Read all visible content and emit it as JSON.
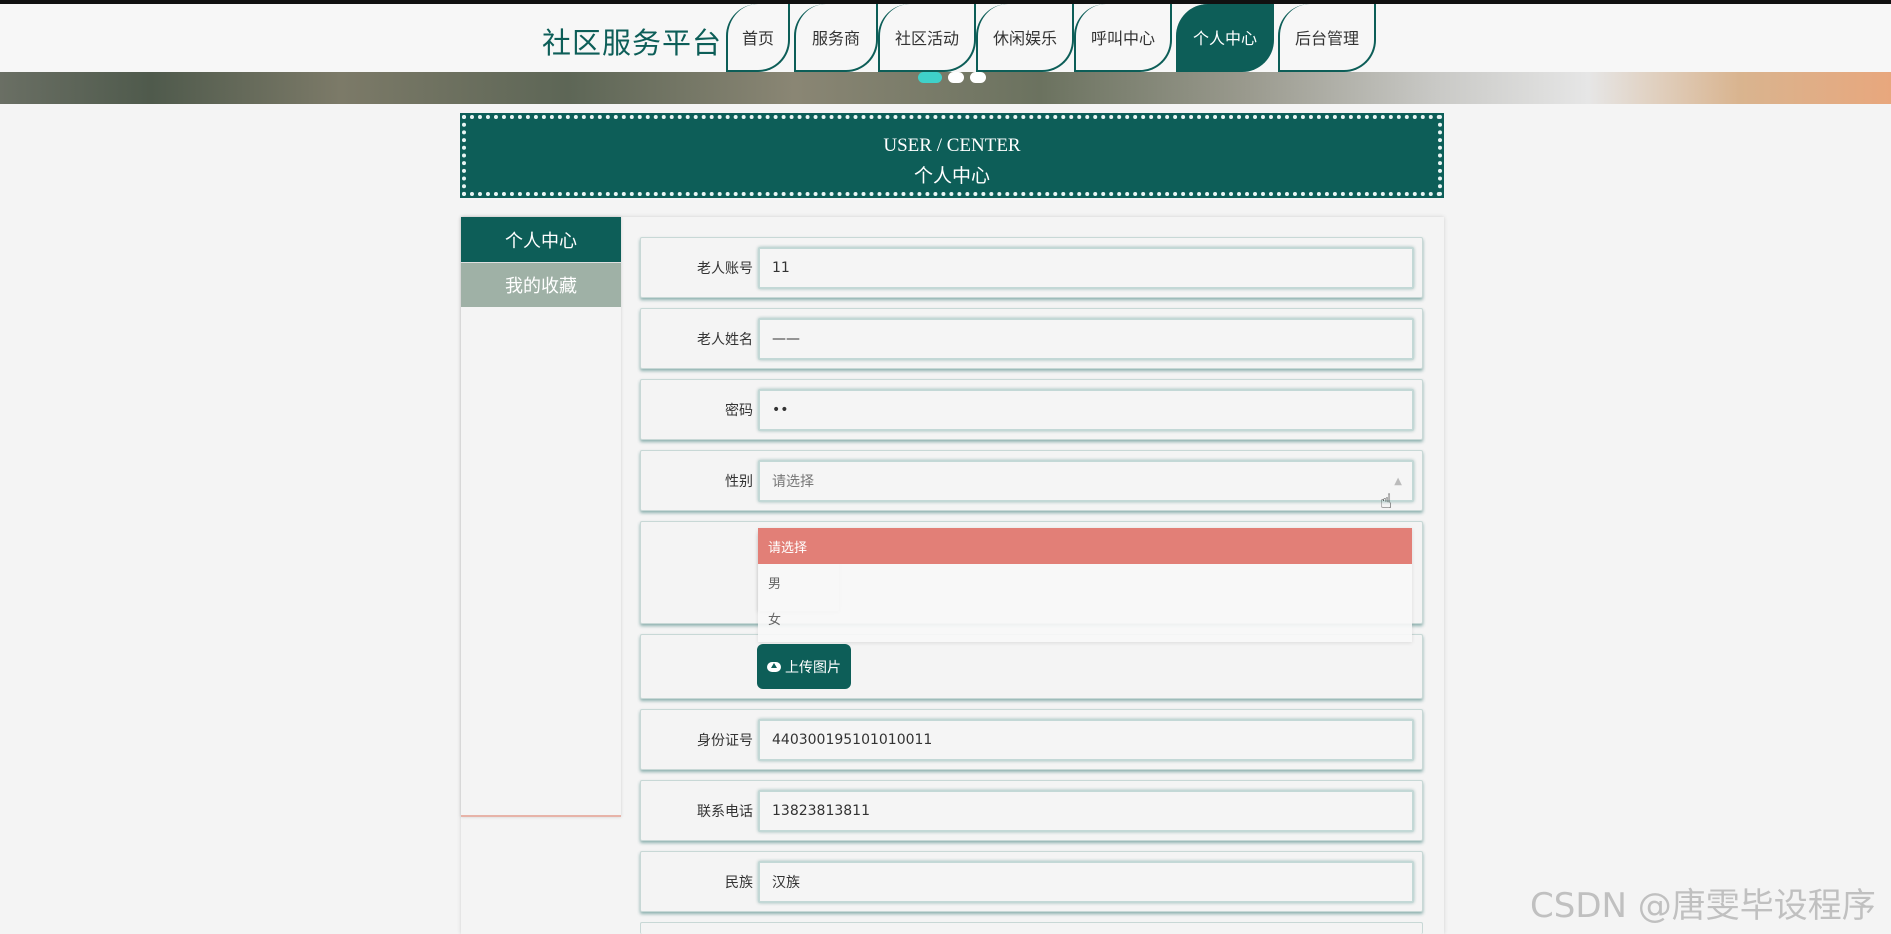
{
  "brand": "社区服务平台",
  "nav": [
    {
      "label": "首页",
      "active": false
    },
    {
      "label": "服务商",
      "active": false
    },
    {
      "label": "社区活动",
      "active": false
    },
    {
      "label": "休闲娱乐",
      "active": false
    },
    {
      "label": "呼叫中心",
      "active": false
    },
    {
      "label": "个人中心",
      "active": true
    },
    {
      "label": "后台管理",
      "active": false
    }
  ],
  "title": {
    "en": "USER / CENTER",
    "cn": "个人中心"
  },
  "sidebar": [
    {
      "label": "个人中心",
      "active": true
    },
    {
      "label": "我的收藏",
      "active": false
    }
  ],
  "form": {
    "account": {
      "label": "老人账号",
      "value": "11"
    },
    "name": {
      "label": "老人姓名",
      "value": "——"
    },
    "password": {
      "label": "密码",
      "value": "••"
    },
    "gender": {
      "label": "性别",
      "placeholder": "请选择",
      "options": [
        "请选择",
        "男",
        "女"
      ],
      "selected": "请选择"
    },
    "upload_label": "上传图片",
    "idcard": {
      "label": "身份证号",
      "value": "440300195101010011"
    },
    "phone": {
      "label": "联系电话",
      "value": "13823813811"
    },
    "ethnicity": {
      "label": "民族",
      "value": "汉族"
    }
  },
  "watermark": "CSDN @唐雯毕设程序",
  "colors": {
    "primary": "#0d5e58",
    "accent_selected": "#e27f77",
    "sidebar_inactive": "#9fb1a6"
  }
}
